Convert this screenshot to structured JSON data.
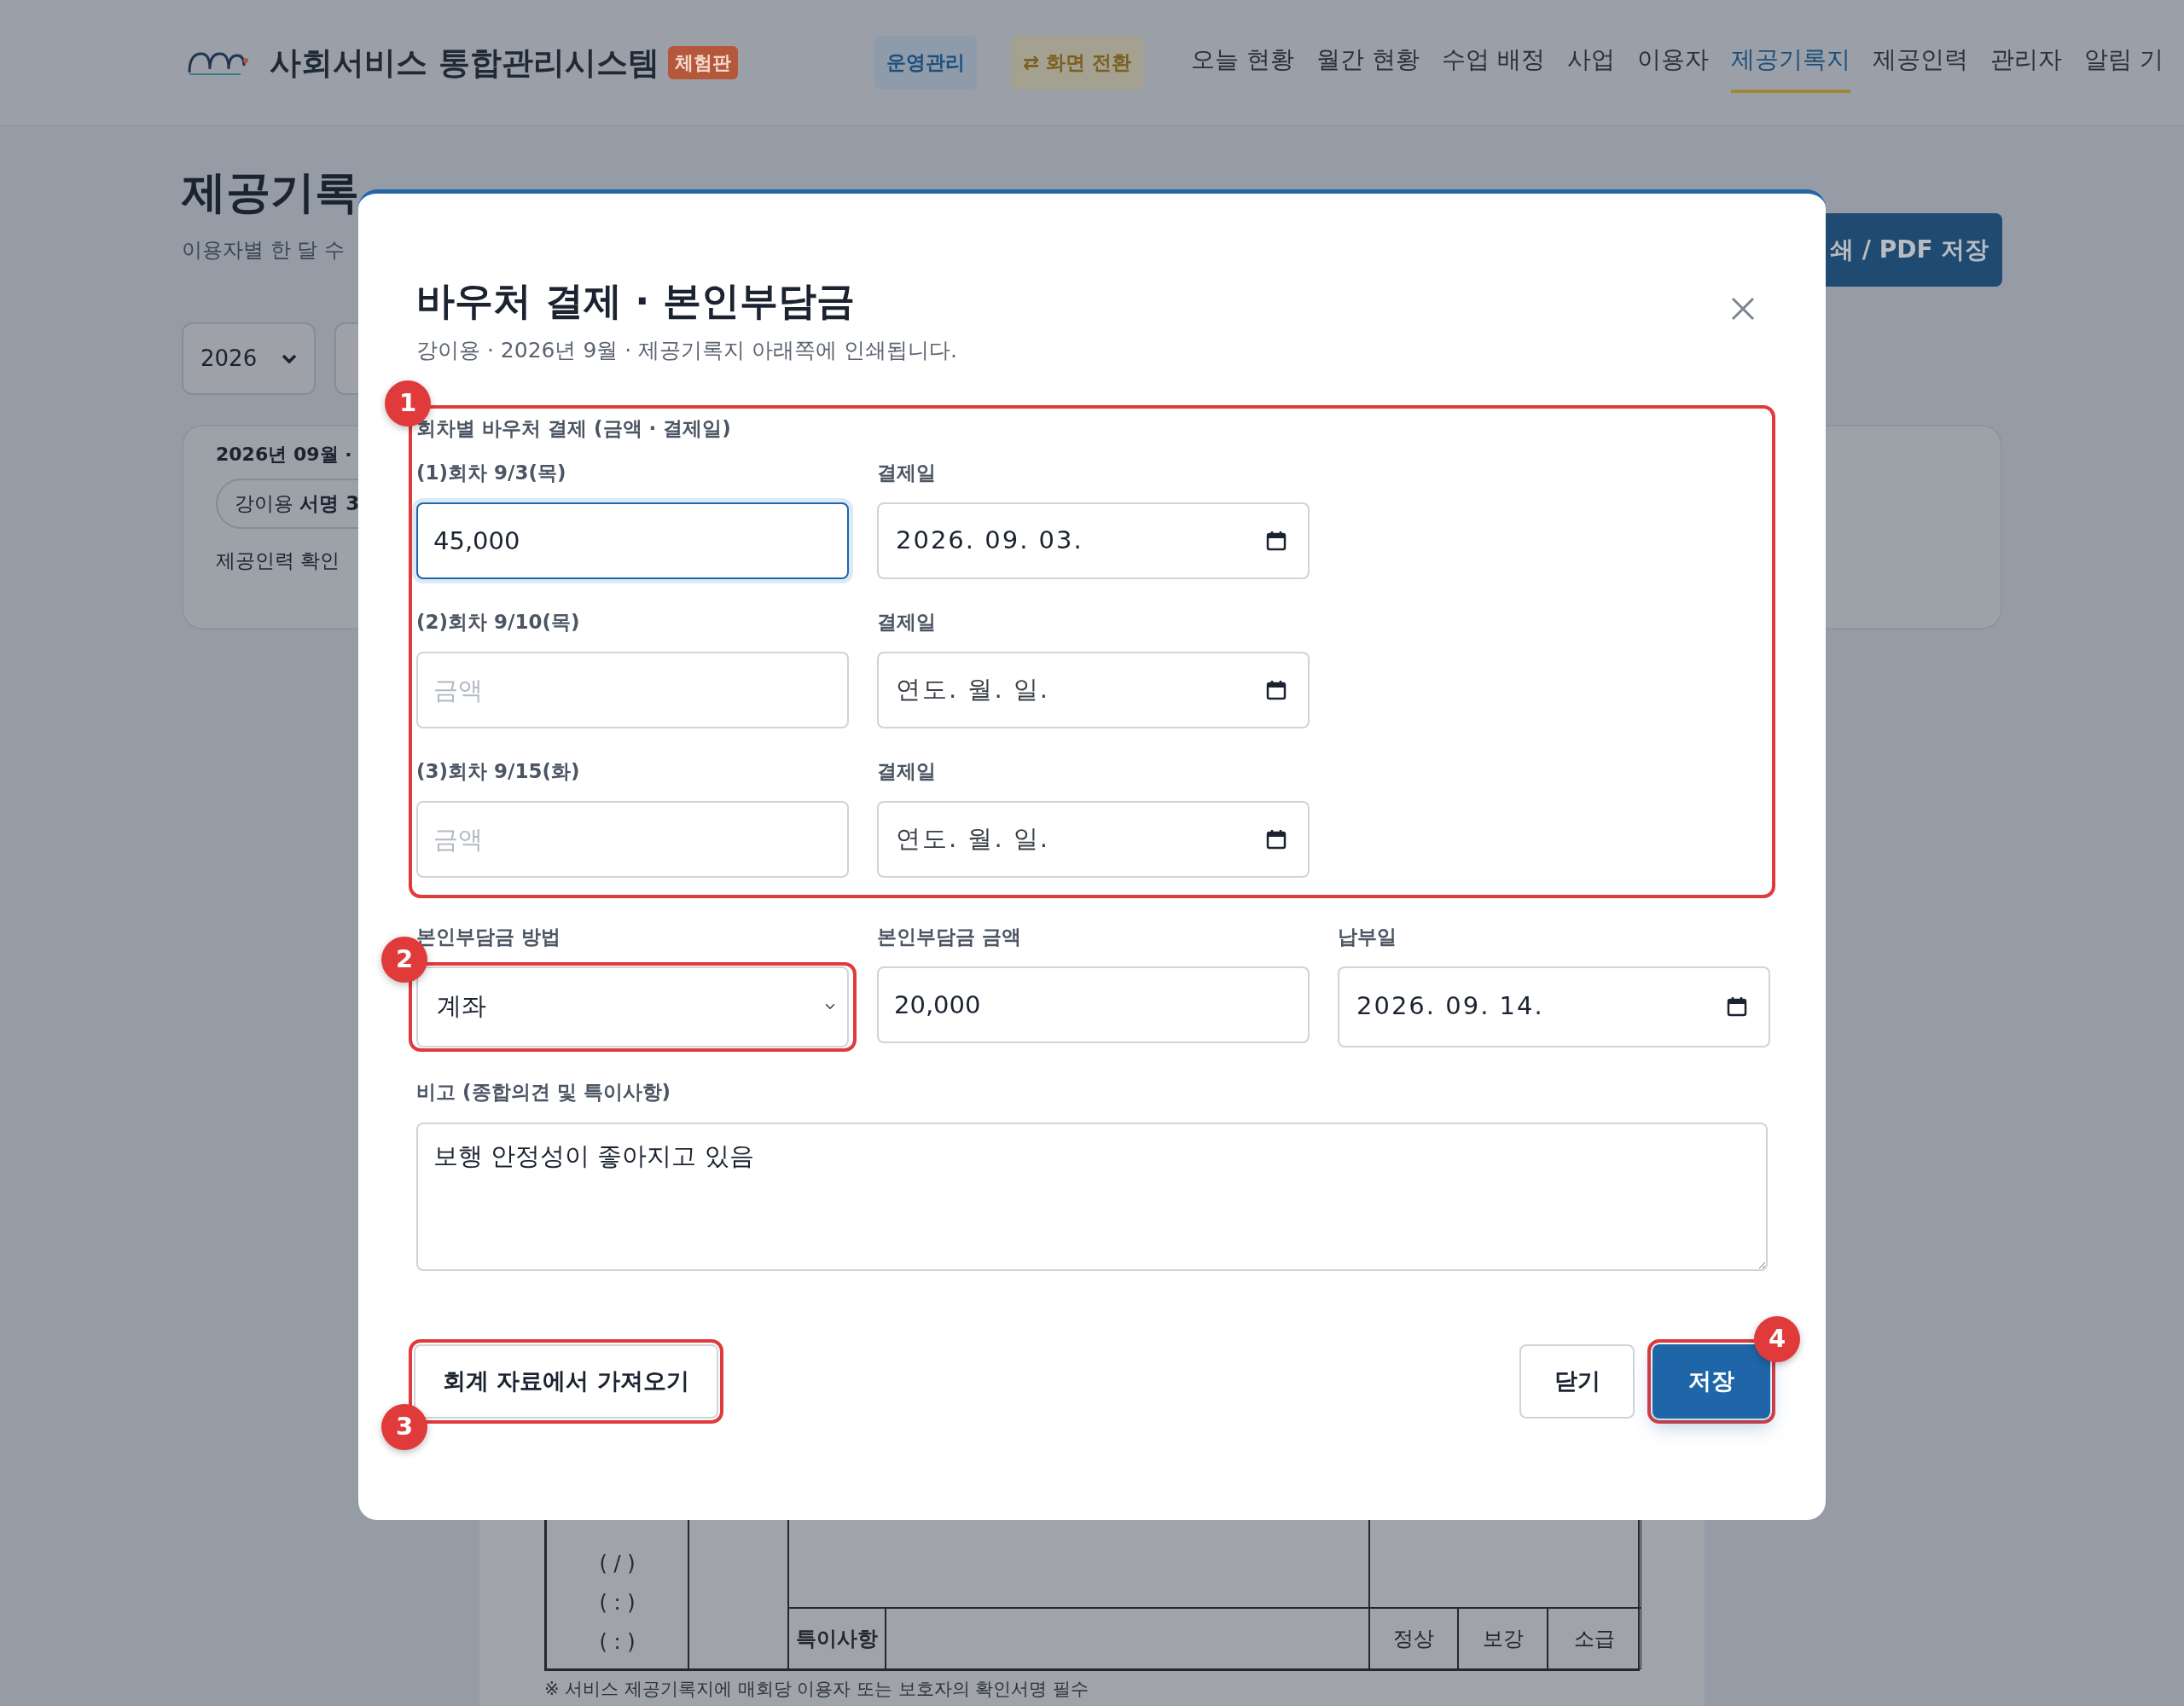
{
  "navbar": {
    "brand": "사회서비스 통합관리시스템",
    "badge": "체험판",
    "pills": [
      {
        "kind": "mode",
        "label": "운영관리"
      },
      {
        "kind": "switch",
        "label": "⇄ 화면 전환"
      }
    ],
    "items": [
      {
        "label": "오늘 현황",
        "selected": false
      },
      {
        "label": "월간 현황",
        "selected": false
      },
      {
        "label": "수업 배정",
        "selected": false
      },
      {
        "label": "사업",
        "selected": false
      },
      {
        "label": "이용자",
        "selected": false
      },
      {
        "label": "제공기록지",
        "selected": true
      },
      {
        "label": "제공인력",
        "selected": false
      },
      {
        "label": "관리자",
        "selected": false
      },
      {
        "label": "알림 기",
        "selected": false
      }
    ]
  },
  "page": {
    "title": "제공기록",
    "subtitle": "이용자별 한 달 수",
    "print_button": "쇄 / PDF 저장",
    "year_select": "2026",
    "summary": {
      "heading": "2026년 09월 ·",
      "chip": "강이용 **서명 3**",
      "note": "제공인력 확인"
    },
    "record_table": {
      "round_cells": [
        "( / )",
        "( : )",
        "( : )"
      ],
      "remarks_label": "특이사항",
      "status_cells": [
        "정상",
        "보강",
        "소급"
      ]
    },
    "footnote": "※ 서비스 제공기록지에 매회당 이용자 또는 보호자의 확인서명 필수"
  },
  "modal": {
    "title": "바우처 결제 · 본인부담금",
    "subtitle": "강이용 · 2026년 9월 · 제공기록지 아래쪽에 인쇄됩니다.",
    "voucher_section": {
      "callout": "1",
      "label": "회차별 바우처 결제 (금액 · 결제일)",
      "rounds": [
        {
          "label": "(1)회차 9/3(목)",
          "amount": {
            "value": "45,000",
            "focused": true
          },
          "date_label": "결제일",
          "date": {
            "value": "2026. 09. 03."
          }
        },
        {
          "label": "(2)회차 9/10(목)",
          "amount": {
            "placeholder": "금액",
            "focused": false
          },
          "date_label": "결제일",
          "date": {
            "placeholder": "연도. 월. 일."
          }
        },
        {
          "label": "(3)회차 9/15(화)",
          "amount": {
            "placeholder": "금액",
            "focused": false
          },
          "date_label": "결제일",
          "date": {
            "placeholder": "연도. 월. 일."
          }
        }
      ]
    },
    "copay": {
      "method_label": "본인부담금 방법",
      "method": {
        "value": "계좌",
        "callout": "2"
      },
      "amount_label": "본인부담금 금액",
      "amount": "20,000",
      "date_label": "납부일",
      "date": {
        "value": "2026. 09. 14."
      }
    },
    "remarks": {
      "label": "비고 (종합의견 및 특이사항)",
      "value": "보행 안정성이 좋아지고 있음"
    },
    "buttons": [
      {
        "kind": "import",
        "label": "회계 자료에서 가져오기",
        "callout": "3"
      },
      {
        "kind": "close",
        "label": "닫기"
      },
      {
        "kind": "save",
        "label": "저장",
        "callout": "4"
      }
    ]
  }
}
